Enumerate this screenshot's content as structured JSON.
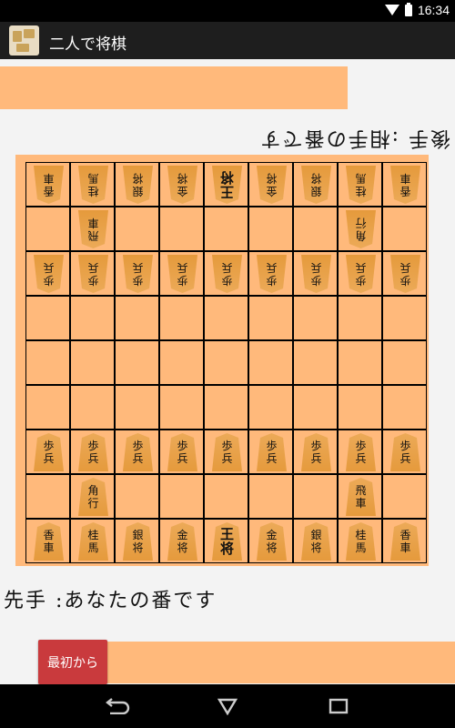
{
  "status_bar": {
    "time": "16:34"
  },
  "app": {
    "title": "二人で将棋",
    "icon": "shogi-app-icon"
  },
  "messages": {
    "gote": "後手 :相手の番です",
    "sente": "先手 :あなたの番です"
  },
  "buttons": {
    "reset_label": "最初から"
  },
  "board": {
    "rows": [
      [
        [
          "香",
          "車",
          "g"
        ],
        [
          "桂",
          "馬",
          "g"
        ],
        [
          "銀",
          "将",
          "g"
        ],
        [
          "金",
          "将",
          "g"
        ],
        [
          "王",
          "将",
          "gk"
        ],
        [
          "金",
          "将",
          "g"
        ],
        [
          "銀",
          "将",
          "g"
        ],
        [
          "桂",
          "馬",
          "g"
        ],
        [
          "香",
          "車",
          "g"
        ]
      ],
      [
        null,
        [
          "飛",
          "車",
          "g"
        ],
        null,
        null,
        null,
        null,
        null,
        [
          "角",
          "行",
          "g"
        ],
        null
      ],
      [
        [
          "歩",
          "兵",
          "g"
        ],
        [
          "歩",
          "兵",
          "g"
        ],
        [
          "歩",
          "兵",
          "g"
        ],
        [
          "歩",
          "兵",
          "g"
        ],
        [
          "歩",
          "兵",
          "g"
        ],
        [
          "歩",
          "兵",
          "g"
        ],
        [
          "歩",
          "兵",
          "g"
        ],
        [
          "歩",
          "兵",
          "g"
        ],
        [
          "歩",
          "兵",
          "g"
        ]
      ],
      [
        null,
        null,
        null,
        null,
        null,
        null,
        null,
        null,
        null
      ],
      [
        null,
        null,
        null,
        null,
        null,
        null,
        null,
        null,
        null
      ],
      [
        null,
        null,
        null,
        null,
        null,
        null,
        null,
        null,
        null
      ],
      [
        [
          "歩",
          "兵",
          "s"
        ],
        [
          "歩",
          "兵",
          "s"
        ],
        [
          "歩",
          "兵",
          "s"
        ],
        [
          "歩",
          "兵",
          "s"
        ],
        [
          "歩",
          "兵",
          "s"
        ],
        [
          "歩",
          "兵",
          "s"
        ],
        [
          "歩",
          "兵",
          "s"
        ],
        [
          "歩",
          "兵",
          "s"
        ],
        [
          "歩",
          "兵",
          "s"
        ]
      ],
      [
        null,
        [
          "角",
          "行",
          "s"
        ],
        null,
        null,
        null,
        null,
        null,
        [
          "飛",
          "車",
          "s"
        ],
        null
      ],
      [
        [
          "香",
          "車",
          "s"
        ],
        [
          "桂",
          "馬",
          "s"
        ],
        [
          "銀",
          "将",
          "s"
        ],
        [
          "金",
          "将",
          "s"
        ],
        [
          "王",
          "将",
          "sk"
        ],
        [
          "金",
          "将",
          "s"
        ],
        [
          "銀",
          "将",
          "s"
        ],
        [
          "桂",
          "馬",
          "s"
        ],
        [
          "香",
          "車",
          "s"
        ]
      ]
    ]
  },
  "colors": {
    "accent": "#ffb97b",
    "piece": "#e8a24d",
    "reset_button": "#c93a3d"
  },
  "nav": {
    "back": "back-icon",
    "home": "home-icon",
    "recents": "recents-icon"
  }
}
